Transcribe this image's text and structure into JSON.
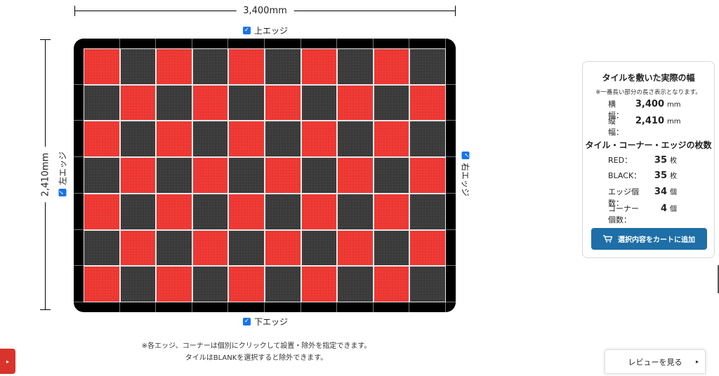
{
  "dimensions": {
    "width_label": "3,400mm",
    "height_label": "2,410mm"
  },
  "edges": {
    "top": "上エッジ",
    "bottom": "下エッジ",
    "left": "左エッジ",
    "right": "右エッジ",
    "checkbox_glyph": "✓"
  },
  "board": {
    "columns": 10,
    "rows": 7,
    "first_tile": "red",
    "colors": {
      "red": "#f23a35",
      "black": "#3a3a3a",
      "edge": "#000000"
    }
  },
  "notes": {
    "line1": "※各エッジ、コーナーは個別にクリックして設置・除外を指定できます。",
    "line2": "タイルはBLANKを選択すると除外できます。"
  },
  "panel": {
    "title": "タイルを敷いた実際の幅",
    "subtitle": "※一番長い部分の長さ表示となります。",
    "width_key": "横幅：",
    "width_value": "3,400",
    "width_unit": "mm",
    "height_key": "縦幅：",
    "height_value": "2,410",
    "height_unit": "mm",
    "count_title": "タイル・コーナー・エッジの枚数",
    "red_key": "RED：",
    "red_value": "35",
    "red_unit": "枚",
    "black_key": "BLACK：",
    "black_value": "35",
    "black_unit": "枚",
    "edge_key": "エッジ個数：",
    "edge_value": "34",
    "edge_unit": "個",
    "corner_key": "コーナー個数：",
    "corner_value": "4",
    "corner_unit": "個",
    "cart_icon": "cart-icon",
    "cart_label": "選択内容をカートに追加",
    "accent": "#1e6fa8"
  },
  "review": {
    "label": "レビューを見る",
    "arrow": "▸"
  },
  "side_tab": {
    "arrow": "▸"
  }
}
